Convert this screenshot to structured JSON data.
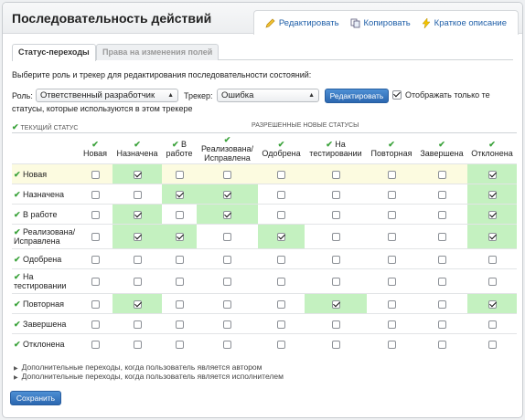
{
  "header": {
    "title": "Последовательность действий",
    "actions": [
      {
        "label": "Редактировать",
        "icon": "pencil-icon"
      },
      {
        "label": "Копировать",
        "icon": "copy-icon"
      },
      {
        "label": "Краткое описание",
        "icon": "lightning-icon"
      }
    ]
  },
  "tabs": [
    {
      "label": "Статус-переходы",
      "active": true
    },
    {
      "label": "Права на изменения полей",
      "active": false
    }
  ],
  "instruction": "Выберите роль и трекер для редактирования последовательности состояний:",
  "filter": {
    "role_label": "Роль:",
    "role_value": "Ответственный разработчик",
    "tracker_label": "Трекер:",
    "tracker_value": "Ошибка",
    "edit_button": "Редактировать",
    "only_used_line1": "Отображать только те",
    "only_used_line2": "статусы, которые используются в этом трекере",
    "only_used_checked": true
  },
  "matrix": {
    "current_status_header": "ТЕКУЩИЙ СТАТУС",
    "new_status_header": "РАЗРЕШЕННЫЕ НОВЫЕ СТАТУСЫ",
    "columns": [
      {
        "l1": "Новая",
        "l2": ""
      },
      {
        "l1": "Назначена",
        "l2": ""
      },
      {
        "l1": "В",
        "l2": "работе"
      },
      {
        "l1": "Реализована/",
        "l2": "Исправлена"
      },
      {
        "l1": "Одобрена",
        "l2": ""
      },
      {
        "l1": "На",
        "l2": "тестировании"
      },
      {
        "l1": "Повторная",
        "l2": ""
      },
      {
        "l1": "Завершена",
        "l2": ""
      },
      {
        "l1": "Отклонена",
        "l2": ""
      }
    ],
    "rows": [
      {
        "l1": "Новая",
        "l2": "",
        "checks": [
          0,
          1,
          0,
          0,
          0,
          0,
          0,
          0,
          1
        ]
      },
      {
        "l1": "Назначена",
        "l2": "",
        "checks": [
          0,
          0,
          1,
          1,
          0,
          0,
          0,
          0,
          1
        ]
      },
      {
        "l1": "В работе",
        "l2": "",
        "checks": [
          0,
          1,
          0,
          1,
          0,
          0,
          0,
          0,
          1
        ]
      },
      {
        "l1": "Реализована/",
        "l2": "Исправлена",
        "checks": [
          0,
          1,
          1,
          0,
          1,
          0,
          0,
          0,
          1
        ]
      },
      {
        "l1": "Одобрена",
        "l2": "",
        "checks": [
          0,
          0,
          0,
          0,
          0,
          0,
          0,
          0,
          0
        ]
      },
      {
        "l1": "На",
        "l2": "тестировании",
        "checks": [
          0,
          0,
          0,
          0,
          0,
          0,
          0,
          0,
          0
        ]
      },
      {
        "l1": "Повторная",
        "l2": "",
        "checks": [
          0,
          1,
          0,
          0,
          0,
          1,
          0,
          0,
          1
        ]
      },
      {
        "l1": "Завершена",
        "l2": "",
        "checks": [
          0,
          0,
          0,
          0,
          0,
          0,
          0,
          0,
          0
        ]
      },
      {
        "l1": "Отклонена",
        "l2": "",
        "checks": [
          0,
          0,
          0,
          0,
          0,
          0,
          0,
          0,
          0
        ]
      }
    ]
  },
  "extra_author": "Дополнительные переходы, когда пользователь является автором",
  "extra_assignee": "Дополнительные переходы, когда пользователь является исполнителем",
  "save_button": "Сохранить",
  "colors": {
    "accent": "#2b67b0",
    "enabled_cell": "#c4f1c0",
    "highlight_row": "#fcfbe0",
    "check_green": "#3aa23a"
  }
}
